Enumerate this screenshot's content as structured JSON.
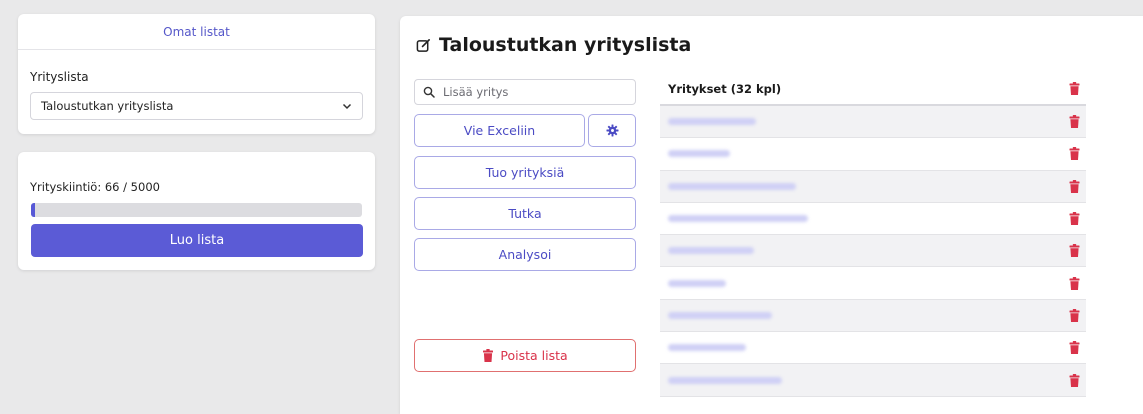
{
  "sidebar": {
    "lists_header": "Omat listat",
    "list_label": "Yrityslista",
    "selected_list": "Taloustutkan yrityslista",
    "quota_text": "Yrityskiintiö: 66 / 5000",
    "quota_used": 66,
    "quota_total": 5000,
    "create_button": "Luo lista"
  },
  "main": {
    "title": "Taloustutkan yrityslista",
    "search_placeholder": "Lisää yritys",
    "buttons": {
      "export": "Vie Exceliin",
      "import": "Tuo yrityksiä",
      "radar": "Tutka",
      "analyze": "Analysoi",
      "delete": "Poista lista"
    },
    "table_header": "Yritykset (32 kpl)",
    "rows": [
      {
        "name_redacted": true
      },
      {
        "name_redacted": true
      },
      {
        "name_redacted": true
      },
      {
        "name_redacted": true
      },
      {
        "name_redacted": true
      },
      {
        "name_redacted": true
      },
      {
        "name_redacted": true
      },
      {
        "name_redacted": true
      },
      {
        "name_redacted": true
      }
    ]
  },
  "colors": {
    "accent": "#5b5bd6",
    "danger": "#d9334a",
    "background": "#e9e9ea"
  },
  "icons": {
    "title": "edit-icon",
    "search": "search-icon",
    "settings": "gear-icon",
    "delete": "trash-icon",
    "select": "chevron-down-icon"
  }
}
